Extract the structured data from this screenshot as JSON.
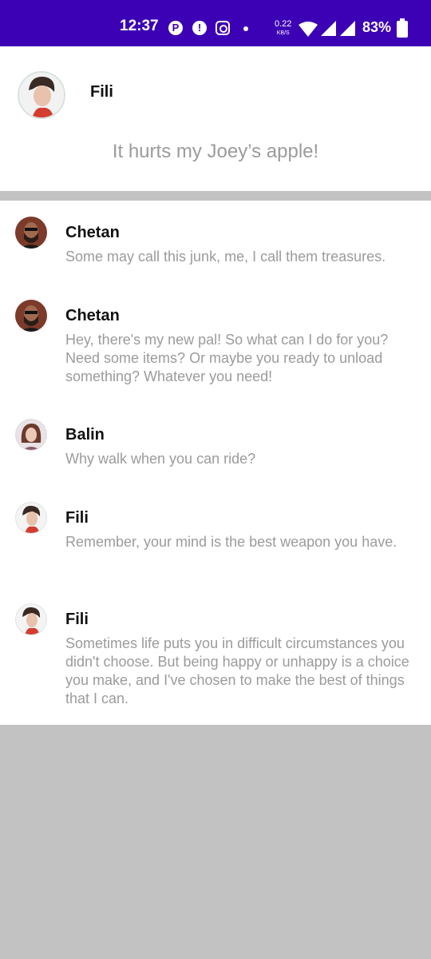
{
  "status_bar": {
    "time": "12:37",
    "speed_value": "0.22",
    "speed_unit": "KB/S",
    "battery": "83%"
  },
  "profile": {
    "name": "Fili",
    "quote": "It hurts my Joey’s apple!"
  },
  "feed": [
    {
      "name": "Chetan",
      "text": "Some may call this junk, me, I call them treasures."
    },
    {
      "name": "Chetan",
      "text": "Hey, there's my new pal! So what can I do for you? Need some items? Or maybe you ready to unload something? Whatever you need!"
    },
    {
      "name": "Balin",
      "text": "Why walk when you can ride?"
    },
    {
      "name": "Fili",
      "text": "Remember, your mind is the best weapon you have."
    },
    {
      "name": "Fili",
      "text": "Sometimes life puts you in difficult circumstances you didn't choose. But being happy or unhappy is a choice you make, and I've chosen to make the best of things that I can."
    }
  ],
  "colors": {
    "status_bar": "#3c00b5",
    "muted_text": "#9b9b9b",
    "divider": "#c2c2c2"
  }
}
